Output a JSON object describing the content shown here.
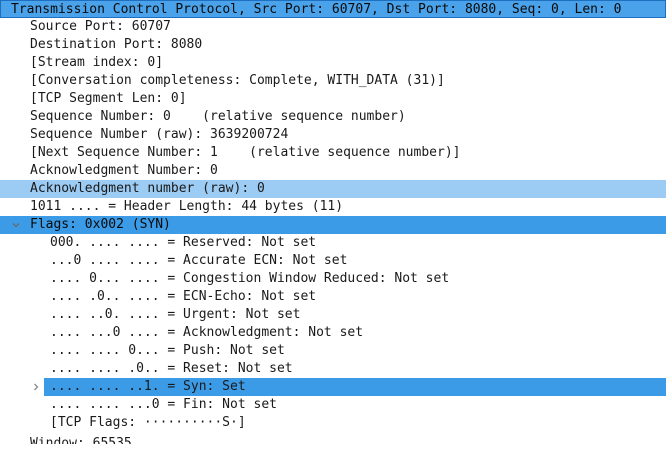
{
  "tree": {
    "header": "Transmission Control Protocol, Src Port: 60707, Dst Port: 8080, Seq: 0, Len: 0",
    "fields": [
      "Source Port: 60707",
      "Destination Port: 8080",
      "[Stream index: 0]",
      "[Conversation completeness: Complete, WITH_DATA (31)]",
      "[TCP Segment Len: 0]",
      "Sequence Number: 0    (relative sequence number)",
      "Sequence Number (raw): 3639200724",
      "[Next Sequence Number: 1    (relative sequence number)]",
      "Acknowledgment Number: 0",
      "Acknowledgment number (raw): 0",
      "1011 .... = Header Length: 44 bytes (11)"
    ],
    "flags_label": "Flags: 0x002 (SYN)",
    "flags": [
      "000. .... .... = Reserved: Not set",
      "...0 .... .... = Accurate ECN: Not set",
      ".... 0... .... = Congestion Window Reduced: Not set",
      ".... .0.. .... = ECN-Echo: Not set",
      ".... ..0. .... = Urgent: Not set",
      ".... ...0 .... = Acknowledgment: Not set",
      ".... .... 0... = Push: Not set",
      ".... .... .0.. = Reset: Not set",
      ".... .... ..1. = Syn: Set",
      ".... .... ...0 = Fin: Not set",
      "[TCP Flags: ··········S·]"
    ],
    "trailing": "Window: 65535"
  },
  "colors": {
    "selection": "#3b9be6",
    "highlight": "#9ccbf3"
  }
}
